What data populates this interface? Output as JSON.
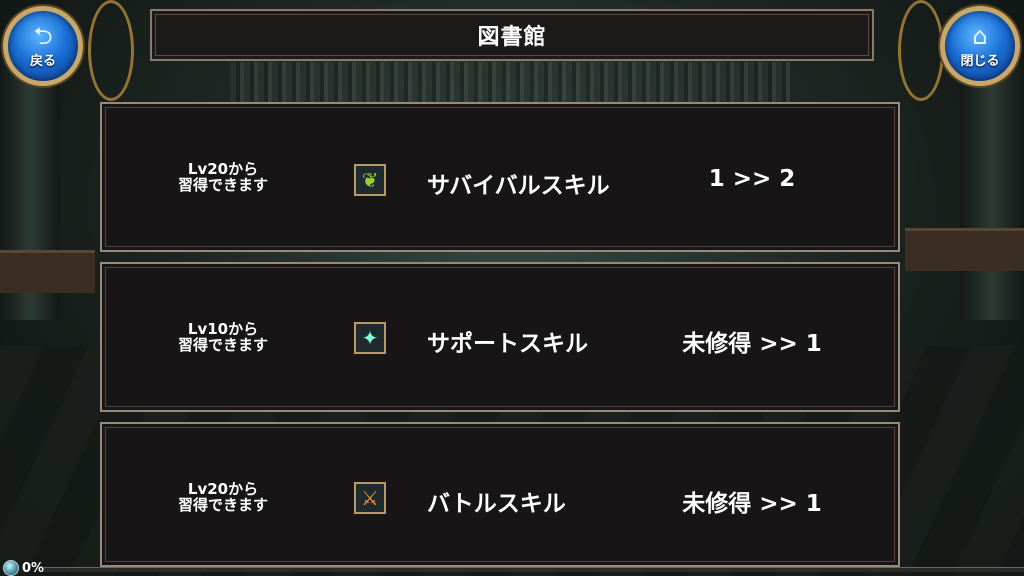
{
  "header": {
    "title": "図書館"
  },
  "buttons": {
    "back_label": "戻る",
    "close_label": "閉じる"
  },
  "skills": [
    {
      "requirement_line1": "Lv20から",
      "requirement_line2": "習得できます",
      "icon": "leaf-swirl-icon",
      "icon_glyph": "❦",
      "icon_color": "#9acd32",
      "name": "サバイバルスキル",
      "level": "1 >> 2"
    },
    {
      "requirement_line1": "Lv10から",
      "requirement_line2": "習得できます",
      "icon": "sparkle-icon",
      "icon_glyph": "✦",
      "icon_color": "#7fffd4",
      "name": "サポートスキル",
      "level": "未修得 >> 1"
    },
    {
      "requirement_line1": "Lv20から",
      "requirement_line2": "習得できます",
      "icon": "crossed-swords-icon",
      "icon_glyph": "⚔",
      "icon_color": "#ff8c3a",
      "name": "バトルスキル",
      "level": "未修得 >> 1"
    }
  ],
  "progress": {
    "text": "0%",
    "value": 0
  }
}
